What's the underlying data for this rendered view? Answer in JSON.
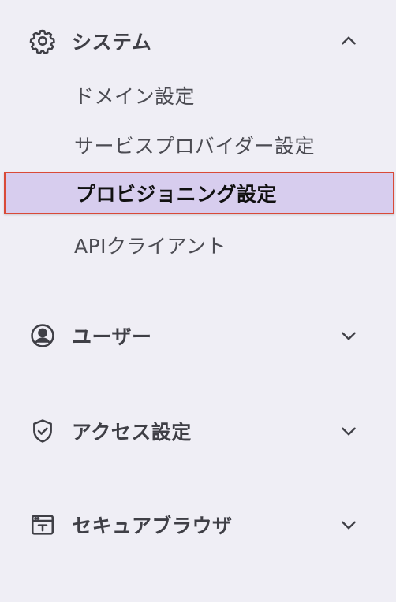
{
  "nav": {
    "system": {
      "label": "システム",
      "icon": "gear-icon",
      "expanded": true,
      "items": [
        {
          "label": "ドメイン設定",
          "active": false
        },
        {
          "label": "サービスプロバイダー設定",
          "active": false
        },
        {
          "label": "プロビジョニング設定",
          "active": true
        },
        {
          "label": "APIクライアント",
          "active": false
        }
      ]
    },
    "users": {
      "label": "ユーザー",
      "icon": "user-circle-icon",
      "expanded": false
    },
    "access": {
      "label": "アクセス設定",
      "icon": "shield-check-icon",
      "expanded": false
    },
    "browser": {
      "label": "セキュアブラウザ",
      "icon": "browser-window-icon",
      "expanded": false
    }
  },
  "colors": {
    "background": "#efeef5",
    "text": "#3f3f46",
    "active_background": "#d7cdee",
    "active_border": "#d94a38"
  }
}
